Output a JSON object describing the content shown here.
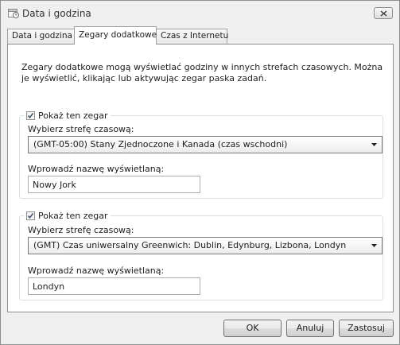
{
  "window": {
    "title": "Data i godzina",
    "icon": "clock-calendar-icon",
    "close": "close-icon"
  },
  "tabs": [
    {
      "label": "Data i godzina",
      "active": false
    },
    {
      "label": "Zegary dodatkowe",
      "active": true
    },
    {
      "label": "Czas z Internetu",
      "active": false
    }
  ],
  "description": "Zegary dodatkowe mogą wyświetlać godziny w innych strefach czasowych. Można je wyświetlić, klikając lub aktywując zegar paska zadań.",
  "clocks": [
    {
      "show_label": "Pokaż ten zegar",
      "checked": true,
      "timezone_label": "Wybierz strefę czasową:",
      "timezone_value": "(GMT-05:00) Stany Zjednoczone i Kanada (czas wschodni)",
      "name_label": "Wprowadź nazwę wyświetlaną:",
      "name_value": "Nowy Jork"
    },
    {
      "show_label": "Pokaż ten zegar",
      "checked": true,
      "timezone_label": "Wybierz strefę czasową:",
      "timezone_value": "(GMT) Czas uniwersalny Greenwich: Dublin, Edynburg, Lizbona, Londyn",
      "name_label": "Wprowadź nazwę wyświetlaną:",
      "name_value": "Londyn"
    }
  ],
  "buttons": {
    "ok": "OK",
    "cancel": "Anuluj",
    "apply": "Zastosuj"
  }
}
